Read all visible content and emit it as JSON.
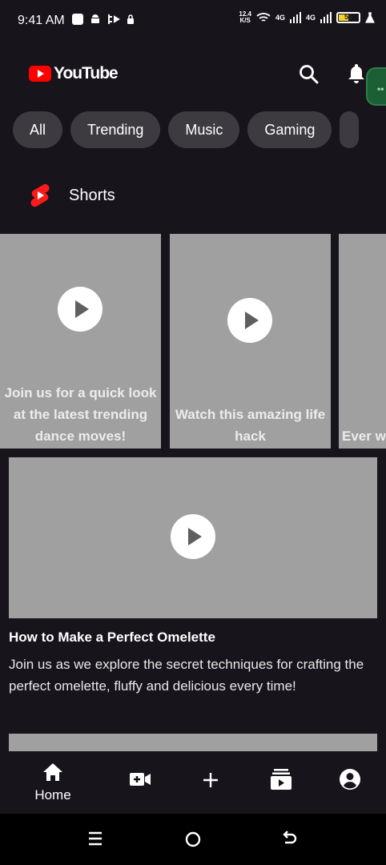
{
  "status_bar": {
    "time": "9:41 AM",
    "net_speed_value": "12.4",
    "net_speed_unit": "K/S",
    "signal1_label": "4G",
    "signal2_label": "4G",
    "battery_level": "55"
  },
  "header": {
    "logo_text": "YouTube"
  },
  "chips": [
    {
      "label": "All"
    },
    {
      "label": "Trending"
    },
    {
      "label": "Music"
    },
    {
      "label": "Gaming"
    }
  ],
  "shorts": {
    "title": "Shorts",
    "cards": [
      {
        "caption": "Join us for a quick look at the latest trending dance moves!"
      },
      {
        "caption": "Watch this amazing life hack"
      },
      {
        "caption": "Ever w... make..."
      }
    ]
  },
  "video": {
    "title": "How to Make a Perfect Omelette",
    "description": "Join us as we explore the secret techniques for crafting the perfect omelette, fluffy and delicious every time!"
  },
  "bottom_nav": {
    "home_label": "Home"
  },
  "colors": {
    "background": "#17141b",
    "chip": "#3d3b40",
    "placeholder": "#a0a0a0",
    "brand_red": "#ff0000"
  }
}
